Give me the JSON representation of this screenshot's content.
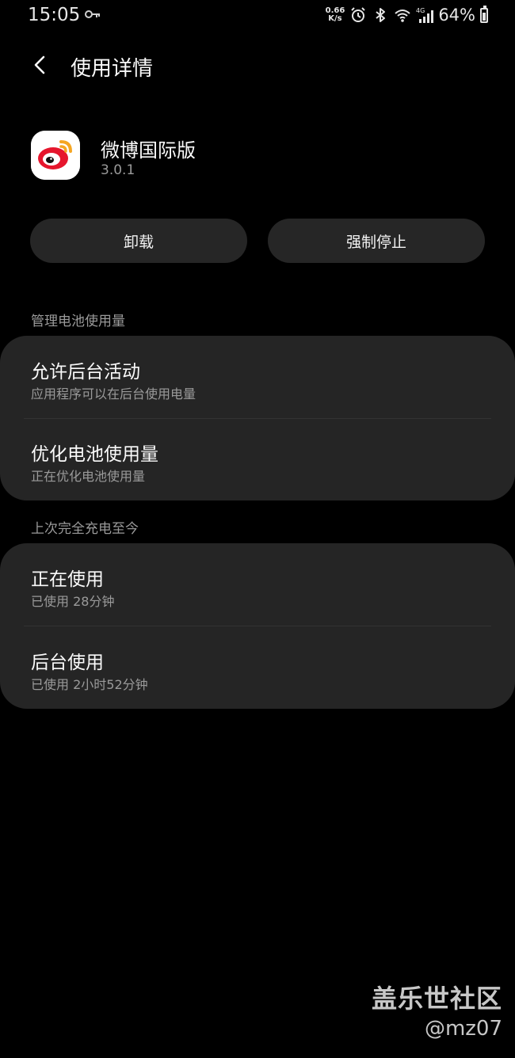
{
  "status_bar": {
    "time": "15:05",
    "net_speed_value": "0.66",
    "net_speed_unit": "K/s",
    "network_type": "4G",
    "battery_percent": "64%",
    "battery_level": 0.64,
    "icons": [
      "vpn-key-icon",
      "alarm-icon",
      "bluetooth-icon",
      "wifi-icon",
      "cellular-signal-icon",
      "battery-icon"
    ]
  },
  "header": {
    "title": "使用详情",
    "back_icon": "chevron-left-icon"
  },
  "app": {
    "name": "微博国际版",
    "version": "3.0.1",
    "icon": "weibo-logo-icon"
  },
  "actions": {
    "uninstall_label": "卸载",
    "force_stop_label": "强制停止"
  },
  "battery_section": {
    "header": "管理电池使用量",
    "items": [
      {
        "title": "允许后台活动",
        "subtitle": "应用程序可以在后台使用电量"
      },
      {
        "title": "优化电池使用量",
        "subtitle": "正在优化电池使用量"
      }
    ]
  },
  "usage_section": {
    "header": "上次完全充电至今",
    "items": [
      {
        "title": "正在使用",
        "subtitle": "已使用 28分钟"
      },
      {
        "title": "后台使用",
        "subtitle": "已使用 2小时52分钟"
      }
    ]
  },
  "watermark": {
    "site": "盖乐世社区",
    "user": "@mz07"
  },
  "colors": {
    "background": "#000000",
    "card": "#252525",
    "button": "#262626",
    "secondary_text": "#9a9a9a",
    "weibo_red": "#e6162d",
    "weibo_orange": "#f5a623"
  }
}
